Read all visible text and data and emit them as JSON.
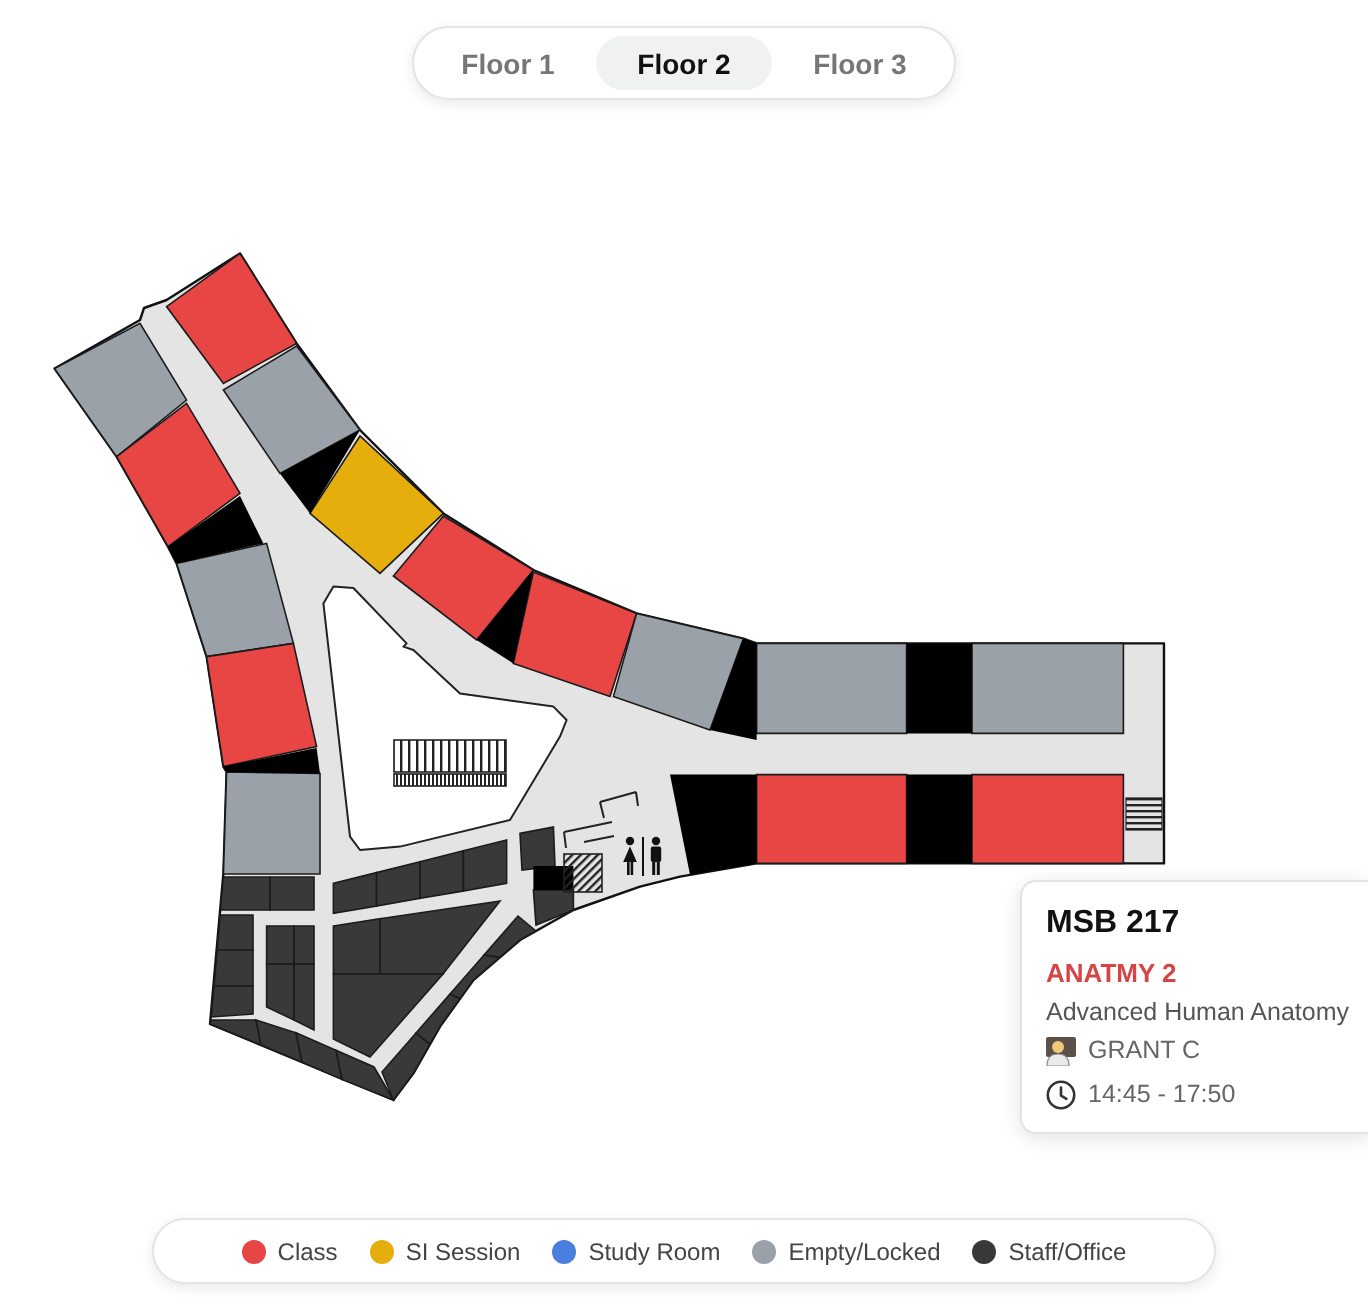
{
  "tabs": [
    {
      "label": "Floor 1",
      "selected": false
    },
    {
      "label": "Floor 2",
      "selected": true
    },
    {
      "label": "Floor 3",
      "selected": false
    }
  ],
  "rooms": [
    {
      "kind": "empty"
    },
    {
      "kind": "class"
    },
    {
      "kind": "empty"
    },
    {
      "kind": "class"
    },
    {
      "kind": "empty"
    },
    {
      "kind": "class"
    },
    {
      "kind": "empty"
    },
    {
      "kind": "si"
    },
    {
      "kind": "class"
    },
    {
      "kind": "class"
    },
    {
      "kind": "empty"
    },
    {
      "kind": "empty"
    },
    {
      "kind": "empty"
    },
    {
      "kind": "class"
    },
    {
      "kind": "class"
    },
    {
      "kind": "staff"
    },
    {
      "kind": "staff"
    },
    {
      "kind": "staff"
    },
    {
      "kind": "staff"
    },
    {
      "kind": "staff"
    },
    {
      "kind": "staff"
    },
    {
      "kind": "staff"
    },
    {
      "kind": "staff"
    },
    {
      "kind": "staff"
    },
    {
      "kind": "staff"
    },
    {
      "kind": "staff"
    },
    {
      "kind": "staff"
    },
    {
      "kind": "staff"
    },
    {
      "kind": "staff"
    },
    {
      "kind": "staff"
    },
    {
      "kind": "staff"
    },
    {
      "kind": "staff"
    },
    {
      "kind": "staff"
    },
    {
      "kind": "staff"
    },
    {
      "kind": "staff"
    },
    {
      "kind": "staff"
    },
    {
      "kind": "staff"
    },
    {
      "kind": "staff"
    },
    {
      "kind": "staff"
    },
    {
      "kind": "staff"
    },
    {
      "kind": "staff"
    }
  ],
  "room_card": {
    "room": "MSB 217",
    "course": "ANATMY 2",
    "title": "Advanced Human Anatomy",
    "instructor": "GRANT C",
    "time": "14:45 - 17:50"
  },
  "legend": [
    {
      "label": "Class",
      "kind": "class",
      "color": "#e84545"
    },
    {
      "label": "SI Session",
      "kind": "si",
      "color": "#e5ae0d"
    },
    {
      "label": "Study Room",
      "kind": "study",
      "color": "#4a7fe0"
    },
    {
      "label": "Empty/Locked",
      "kind": "empty",
      "color": "#9ba1a9"
    },
    {
      "label": "Staff/Office",
      "kind": "staff",
      "color": "#393939"
    }
  ]
}
